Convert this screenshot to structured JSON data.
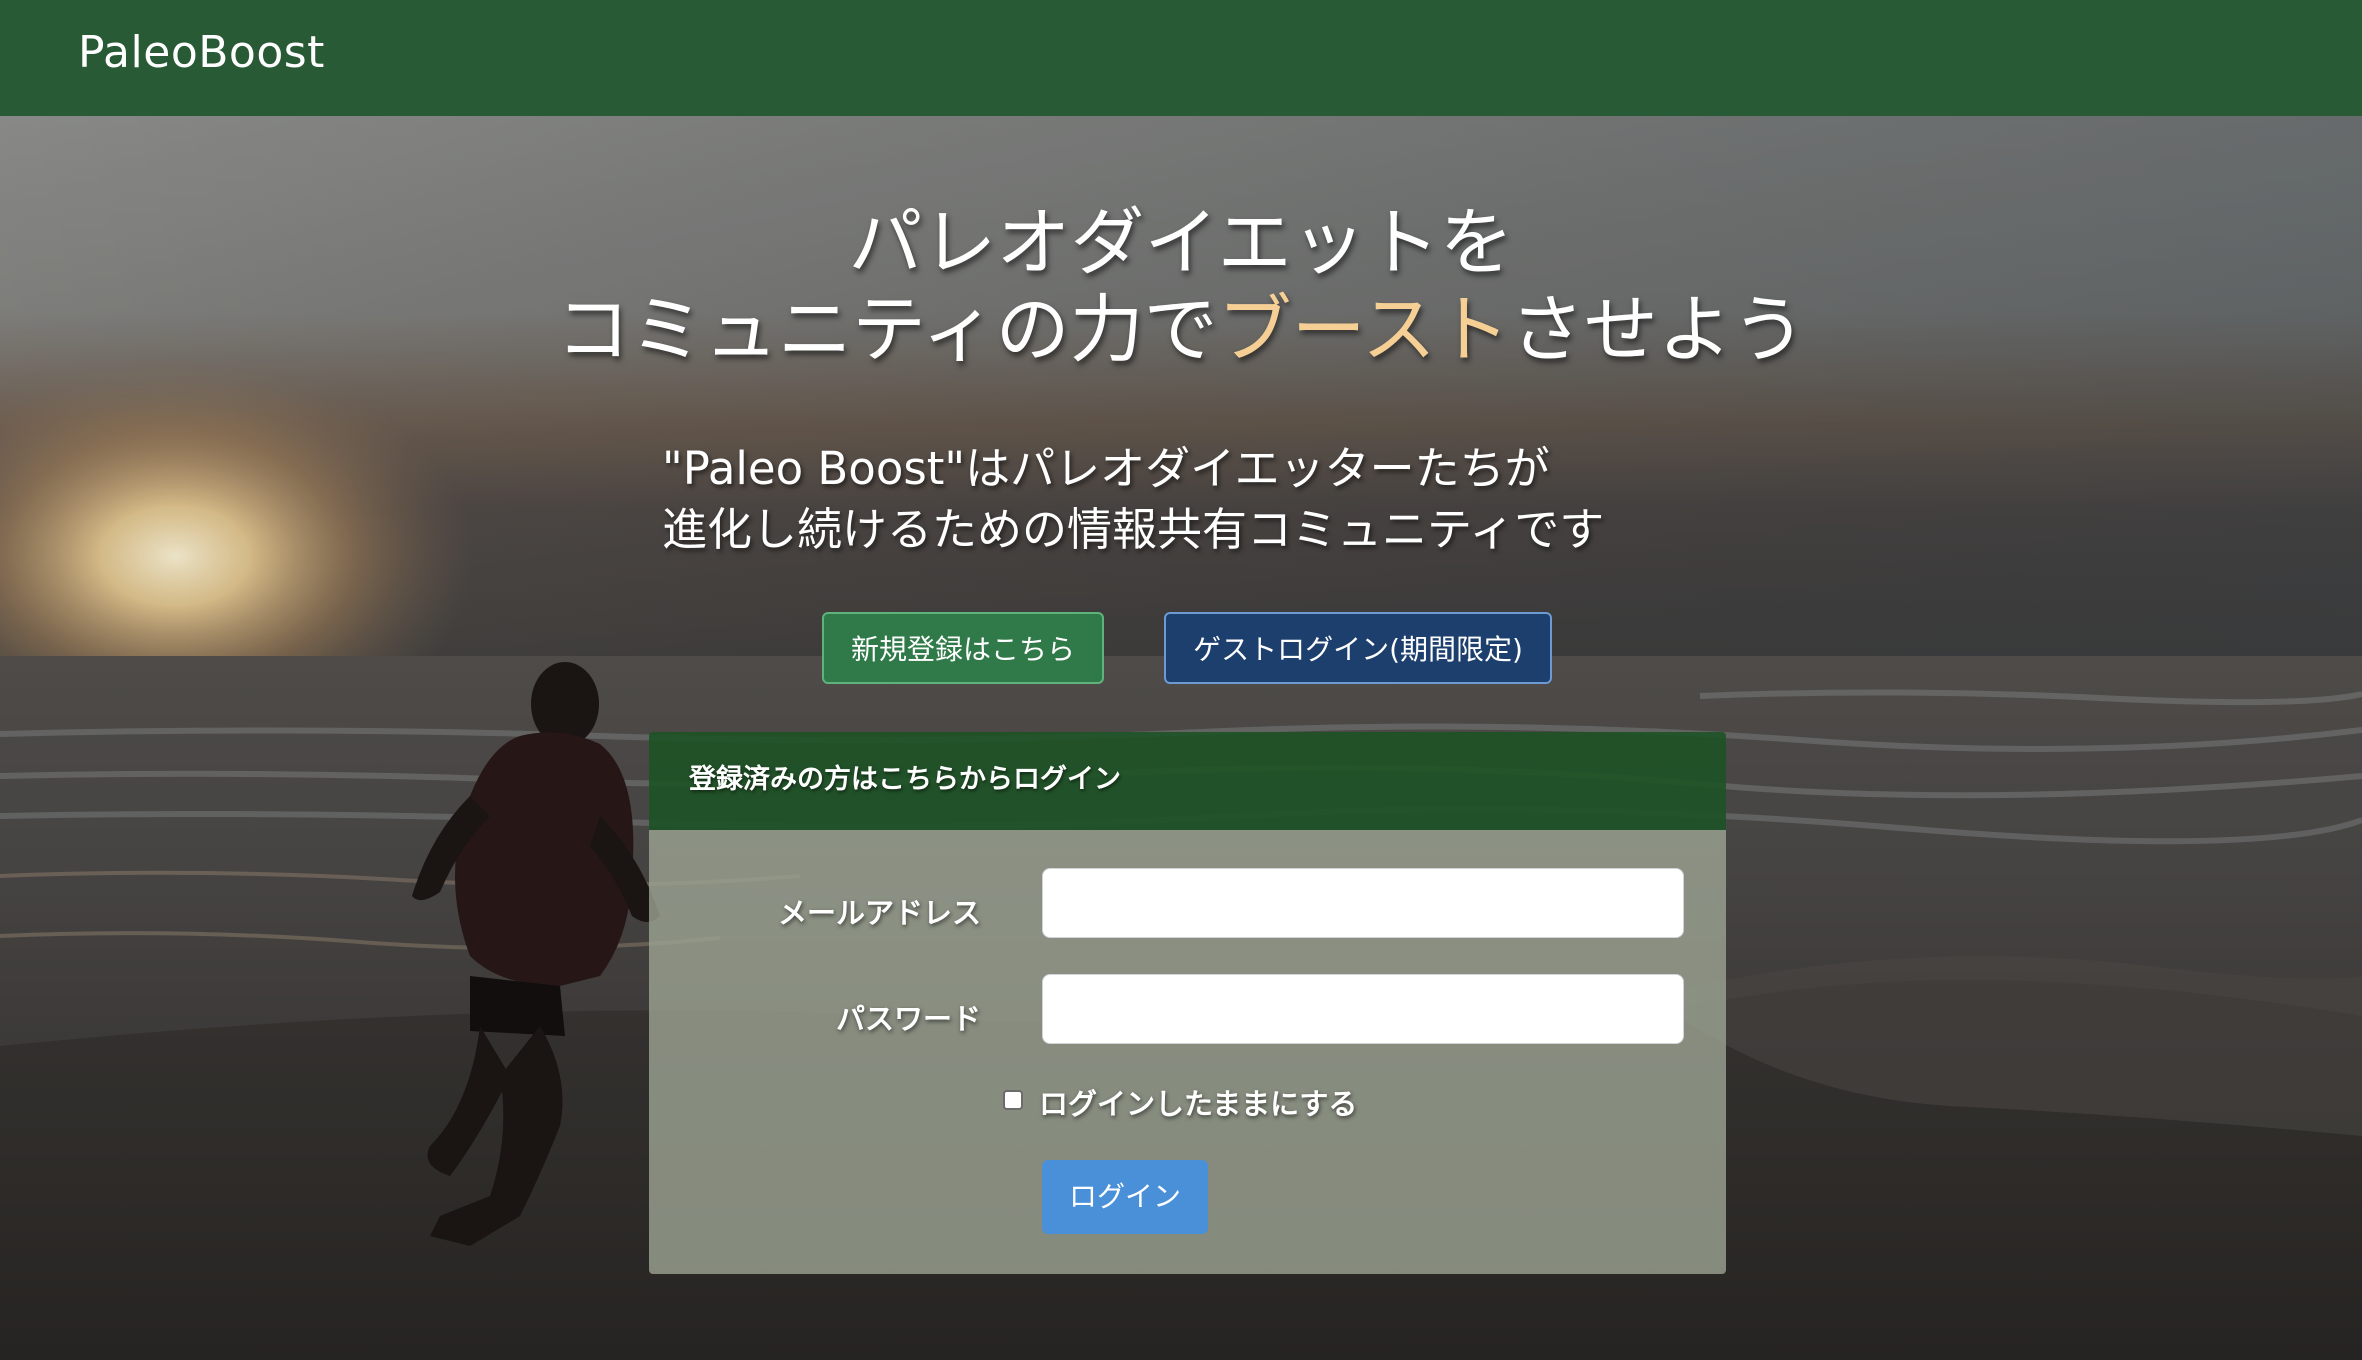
{
  "navbar": {
    "brand": "PaleoBoost"
  },
  "hero": {
    "headline_line1": "パレオダイエットを",
    "headline_line2_pre": "コミュニティの力で",
    "headline_line2_accent": "ブースト",
    "headline_line2_post": "させよう",
    "tagline_line1": "\"Paleo Boost\"はパレオダイエッターたちが",
    "tagline_line2": "進化し続けるための情報共有コミュニティです",
    "signup_button": "新規登録はこちら",
    "guest_button": "ゲストログイン(期間限定)"
  },
  "login_card": {
    "header": "登録済みの方はこちらからログイン",
    "email_label": "メールアドレス",
    "email_value": "",
    "password_label": "パスワード",
    "password_value": "",
    "remember_label": "ログインしたままにする",
    "remember_checked": false,
    "submit_label": "ログイン"
  },
  "colors": {
    "navbar": "#285a35",
    "accent_text": "#f6cf95",
    "signup_button": "#2f7a48",
    "guest_button": "#1c3f6d",
    "login_button": "#4a90d9"
  }
}
